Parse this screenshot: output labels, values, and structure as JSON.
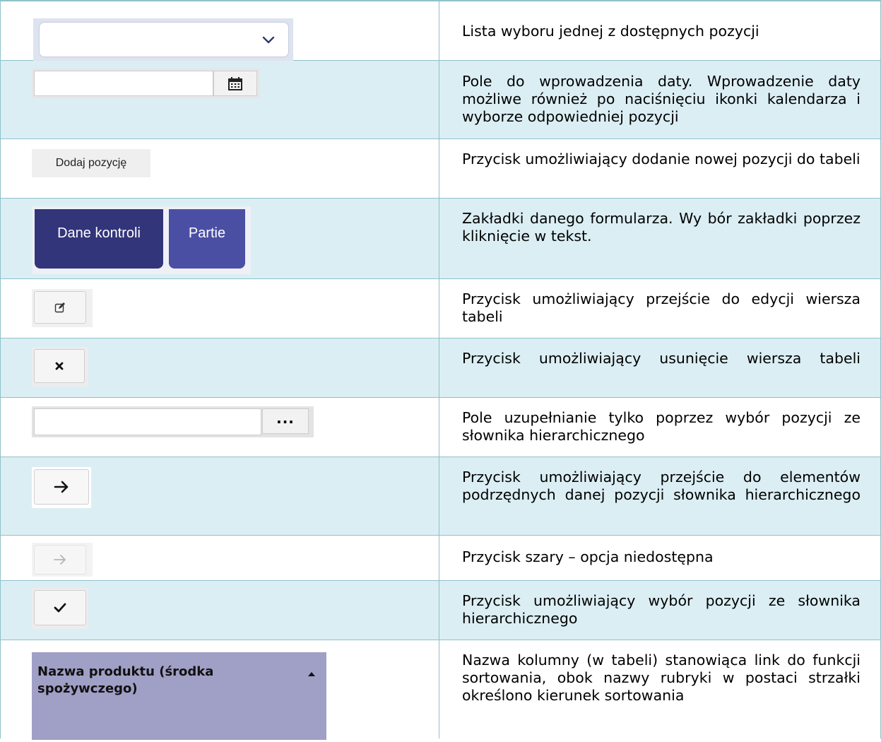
{
  "rows": [
    {
      "widget": "select",
      "icon": "chevron-down-icon",
      "description": "Lista wyboru jednej z dostępnych pozycji"
    },
    {
      "widget": "date-field",
      "icon": "calendar-icon",
      "description": "Pole do wprowadzenia daty. Wprowadzenie daty możliwe również po naciśnięciu ikonki kalendarza i wyborze odpowiedniej pozycji"
    },
    {
      "widget": "add-button",
      "button_label": "Dodaj pozycję",
      "description": "Przycisk umożliwiający dodanie nowej pozycji do tabeli"
    },
    {
      "widget": "tabs",
      "tab1_label": "Dane kontroli",
      "tab2_label": "Partie",
      "description": "Zakładki danego formularza. Wy bór zakładki poprzez kliknięcie w tekst."
    },
    {
      "widget": "edit-button",
      "icon": "edit-icon",
      "description": "Przycisk umożliwiający przejście do edycji wiersza tabeli"
    },
    {
      "widget": "delete-button",
      "icon": "close-icon",
      "description": "Przycisk umożliwiający usunięcie wiersza tabeli"
    },
    {
      "widget": "dictionary-field",
      "button_label": "...",
      "description": "Pole uzupełnianie tylko poprzez wybór pozycji ze słownika hierarchicznego"
    },
    {
      "widget": "arrow-button",
      "icon": "arrow-right-icon",
      "description": "Przycisk umożliwiający przejście do elementów podrzędnych danej pozycji słownika hierarchicznego"
    },
    {
      "widget": "arrow-button-disabled",
      "icon": "arrow-right-icon",
      "description": "Przycisk szary – opcja niedostępna"
    },
    {
      "widget": "check-button",
      "icon": "check-icon",
      "description": "Przycisk umożliwiający wybór pozycji ze słownika hierarchicznego"
    },
    {
      "widget": "column-header",
      "header_label": "Nazwa produktu (środka spożywczego)",
      "icon": "sort-caret-up-icon",
      "description": "Nazwa kolumny (w tabeli) stanowiąca link do funkcji sortowania, obok nazwy rubryki w postaci strzałki określono kierunek sortowania"
    }
  ],
  "colors": {
    "row_alt_bg": "#dbeef4",
    "border": "#8fc1c9",
    "tab_active": "#33357a",
    "tab_inactive": "#4b4fa3",
    "column_header_bg": "#a09fc6"
  }
}
